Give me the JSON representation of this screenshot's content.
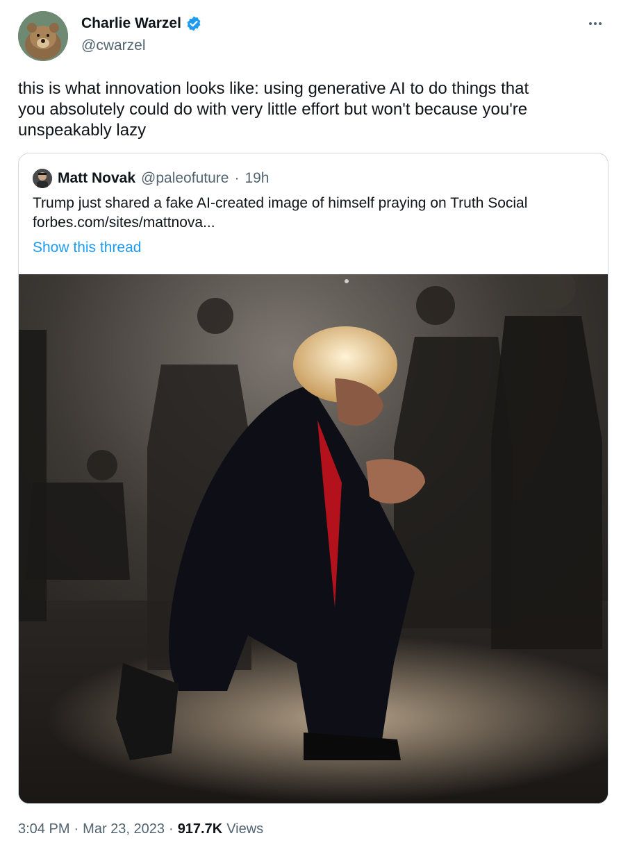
{
  "author": {
    "name": "Charlie Warzel",
    "handle": "@cwarzel",
    "verified_icon": "verified-badge-icon"
  },
  "tweet": {
    "text": "this is what innovation looks like: using generative AI to do things that\nyou absolutely could do with very little effort but won't because you're\nunspeakably lazy"
  },
  "quoted": {
    "name": "Matt Novak",
    "handle": "@paleofuture",
    "separator": "·",
    "age": "19h",
    "text": "Trump just shared a fake AI-created image of himself praying on Truth Social",
    "link": "forbes.com/sites/mattnova...",
    "show_thread": "Show this thread"
  },
  "meta": {
    "time": "3:04 PM",
    "sep1": "·",
    "date": "Mar 23, 2023",
    "sep2": "·",
    "views_count": "917.7K",
    "views_label": "Views"
  },
  "colors": {
    "link_blue": "#1d9bf0",
    "secondary_text": "#536471",
    "border": "#cfd9de"
  }
}
